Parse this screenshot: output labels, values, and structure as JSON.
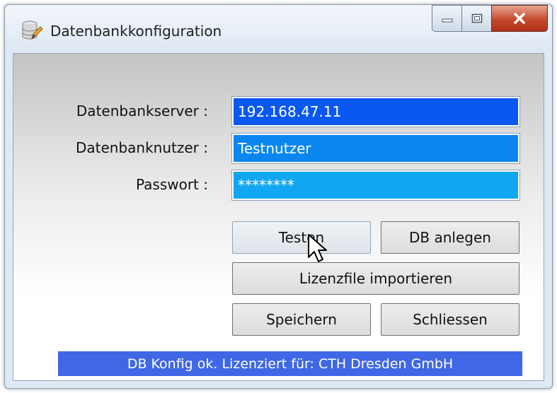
{
  "window": {
    "title": "Datenbankkonfiguration",
    "icon": "database-pencil-icon",
    "controls": {
      "minimize": "minimize-icon",
      "maximize": "maximize-icon",
      "close": "close-icon"
    }
  },
  "form": {
    "server": {
      "label": "Datenbankserver :",
      "value": "192.168.47.11",
      "color": "#0a58f2"
    },
    "user": {
      "label": "Datenbanknutzer :",
      "value": "Testnutzer",
      "color": "#0b86f0"
    },
    "password": {
      "label": "Passwort :",
      "value": "********",
      "color": "#10a6f1"
    }
  },
  "buttons": {
    "test": "Testen",
    "create_db": "DB anlegen",
    "import_license": "Lizenzfile importieren",
    "save": "Speichern",
    "close": "Schliessen"
  },
  "status": {
    "text": "DB Konfig ok. Lizenziert für: CTH Dresden GmbH",
    "color": "#3f67e6"
  },
  "cursor": "mouse-pointer-icon"
}
